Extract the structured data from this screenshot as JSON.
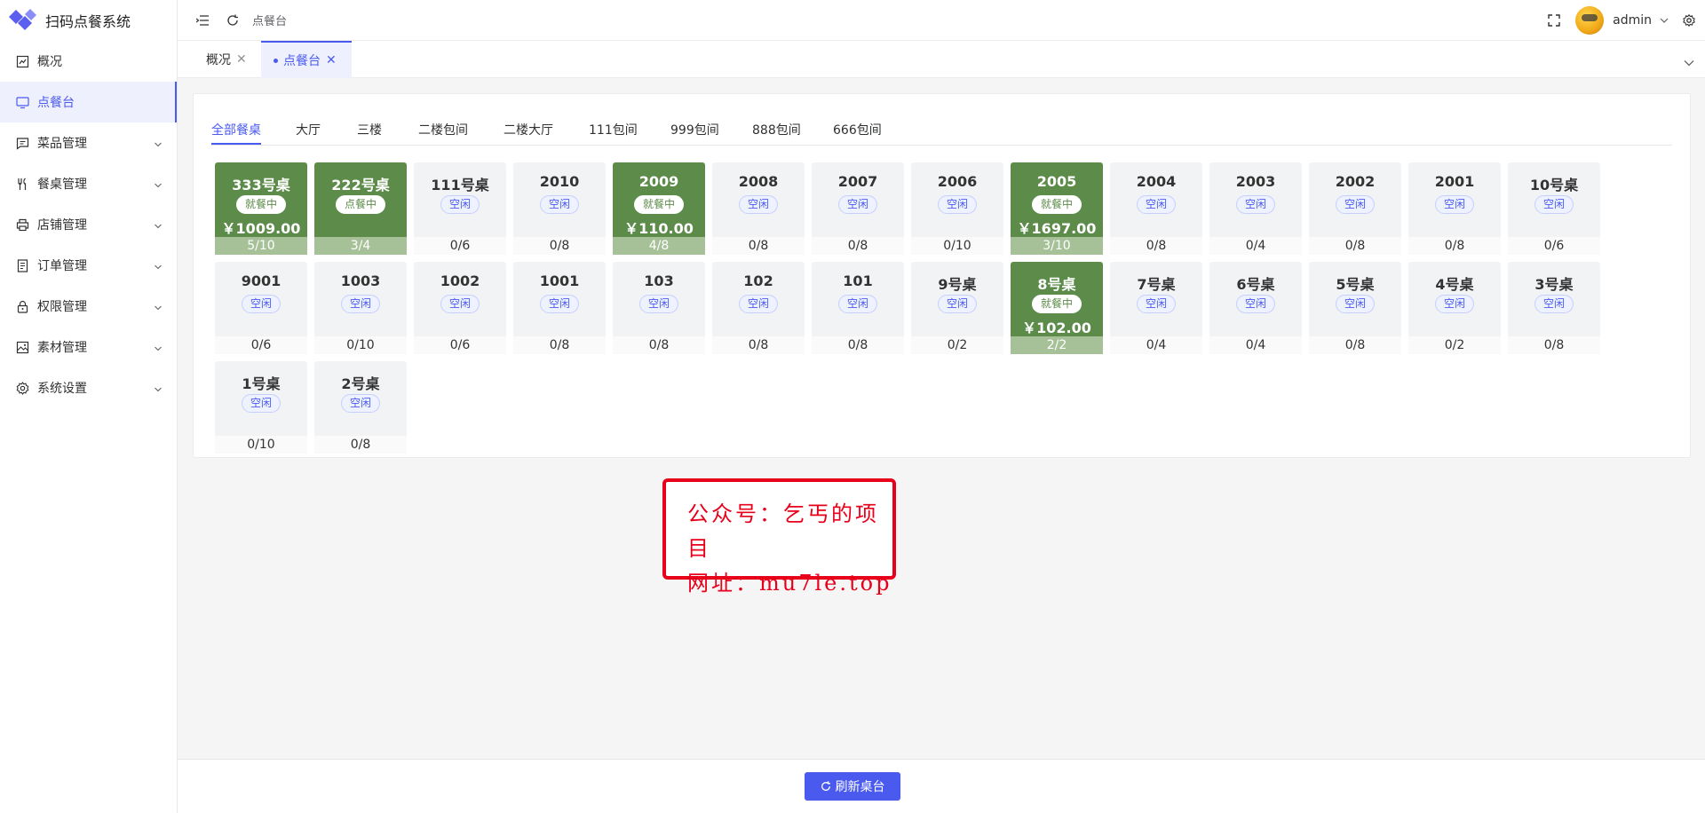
{
  "app": {
    "title": "扫码点餐系统"
  },
  "sidebar": {
    "items": [
      {
        "label": "概况",
        "icon": "chart-icon"
      },
      {
        "label": "点餐台",
        "icon": "monitor-icon"
      },
      {
        "label": "菜品管理",
        "icon": "message-square-icon"
      },
      {
        "label": "餐桌管理",
        "icon": "utensils-icon"
      },
      {
        "label": "店铺管理",
        "icon": "printer-icon"
      },
      {
        "label": "订单管理",
        "icon": "document-icon"
      },
      {
        "label": "权限管理",
        "icon": "lock-icon"
      },
      {
        "label": "素材管理",
        "icon": "image-icon"
      },
      {
        "label": "系统设置",
        "icon": "gear-icon"
      }
    ]
  },
  "header": {
    "breadcrumb": "点餐台",
    "user": "admin"
  },
  "tabs": [
    {
      "label": "概况"
    },
    {
      "label": "点餐台"
    }
  ],
  "areas": [
    "全部餐桌",
    "大厅",
    "三楼",
    "二楼包间",
    "二楼大厅",
    "111包间",
    "999包间",
    "888包间",
    "666包间"
  ],
  "tables": [
    {
      "name": "333号桌",
      "status": "就餐中",
      "amount": "￥1009.00",
      "seats": "5/10",
      "occupied": true
    },
    {
      "name": "222号桌",
      "status": "点餐中",
      "amount": "",
      "seats": "3/4",
      "occupied": true
    },
    {
      "name": "111号桌",
      "status": "空闲",
      "amount": "",
      "seats": "0/6",
      "occupied": false
    },
    {
      "name": "2010",
      "status": "空闲",
      "amount": "",
      "seats": "0/8",
      "occupied": false
    },
    {
      "name": "2009",
      "status": "就餐中",
      "amount": "￥110.00",
      "seats": "4/8",
      "occupied": true
    },
    {
      "name": "2008",
      "status": "空闲",
      "amount": "",
      "seats": "0/8",
      "occupied": false
    },
    {
      "name": "2007",
      "status": "空闲",
      "amount": "",
      "seats": "0/8",
      "occupied": false
    },
    {
      "name": "2006",
      "status": "空闲",
      "amount": "",
      "seats": "0/10",
      "occupied": false
    },
    {
      "name": "2005",
      "status": "就餐中",
      "amount": "￥1697.00",
      "seats": "3/10",
      "occupied": true
    },
    {
      "name": "2004",
      "status": "空闲",
      "amount": "",
      "seats": "0/8",
      "occupied": false
    },
    {
      "name": "2003",
      "status": "空闲",
      "amount": "",
      "seats": "0/4",
      "occupied": false
    },
    {
      "name": "2002",
      "status": "空闲",
      "amount": "",
      "seats": "0/8",
      "occupied": false
    },
    {
      "name": "2001",
      "status": "空闲",
      "amount": "",
      "seats": "0/8",
      "occupied": false
    },
    {
      "name": "10号桌",
      "status": "空闲",
      "amount": "",
      "seats": "0/6",
      "occupied": false
    },
    {
      "name": "9001",
      "status": "空闲",
      "amount": "",
      "seats": "0/6",
      "occupied": false
    },
    {
      "name": "1003",
      "status": "空闲",
      "amount": "",
      "seats": "0/10",
      "occupied": false
    },
    {
      "name": "1002",
      "status": "空闲",
      "amount": "",
      "seats": "0/6",
      "occupied": false
    },
    {
      "name": "1001",
      "status": "空闲",
      "amount": "",
      "seats": "0/8",
      "occupied": false
    },
    {
      "name": "103",
      "status": "空闲",
      "amount": "",
      "seats": "0/8",
      "occupied": false
    },
    {
      "name": "102",
      "status": "空闲",
      "amount": "",
      "seats": "0/8",
      "occupied": false
    },
    {
      "name": "101",
      "status": "空闲",
      "amount": "",
      "seats": "0/8",
      "occupied": false
    },
    {
      "name": "9号桌",
      "status": "空闲",
      "amount": "",
      "seats": "0/2",
      "occupied": false
    },
    {
      "name": "8号桌",
      "status": "就餐中",
      "amount": "￥102.00",
      "seats": "2/2",
      "occupied": true
    },
    {
      "name": "7号桌",
      "status": "空闲",
      "amount": "",
      "seats": "0/4",
      "occupied": false
    },
    {
      "name": "6号桌",
      "status": "空闲",
      "amount": "",
      "seats": "0/4",
      "occupied": false
    },
    {
      "name": "5号桌",
      "status": "空闲",
      "amount": "",
      "seats": "0/8",
      "occupied": false
    },
    {
      "name": "4号桌",
      "status": "空闲",
      "amount": "",
      "seats": "0/2",
      "occupied": false
    },
    {
      "name": "3号桌",
      "status": "空闲",
      "amount": "",
      "seats": "0/8",
      "occupied": false
    },
    {
      "name": "1号桌",
      "status": "空闲",
      "amount": "",
      "seats": "0/10",
      "occupied": false
    },
    {
      "name": "2号桌",
      "status": "空闲",
      "amount": "",
      "seats": "0/8",
      "occupied": false
    }
  ],
  "watermark": {
    "line1": "公众号：乞丐的项目",
    "line2": "网址：mu7le.top"
  },
  "footer": {
    "refresh_label": "刷新桌台"
  },
  "colors": {
    "accent": "#4a5aef",
    "occupied": "#5d8c4a",
    "occupied_footer": "#a6c198",
    "watermark": "#e8001a"
  }
}
